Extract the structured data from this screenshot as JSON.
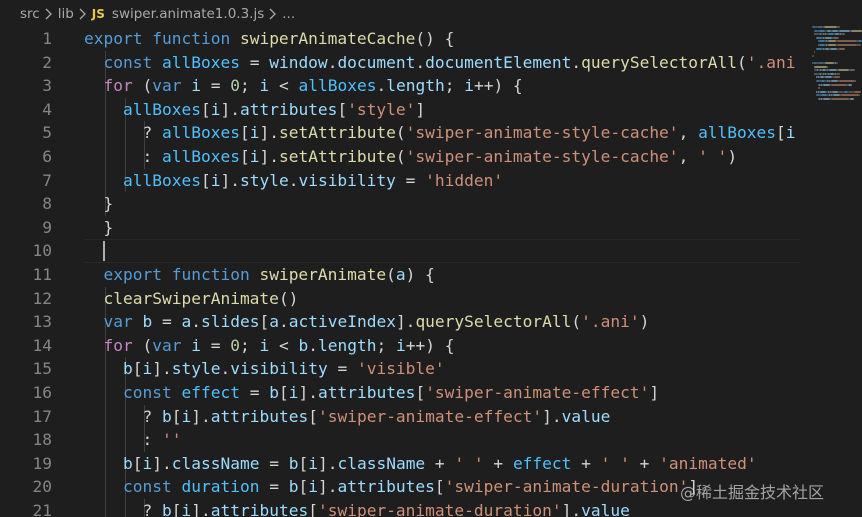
{
  "breadcrumb": {
    "items": [
      "src",
      "lib"
    ],
    "file_badge": "JS",
    "file_name": "swiper.animate1.0.3.js",
    "ellipsis": "..."
  },
  "editor": {
    "lines": [
      {
        "n": "1",
        "indent": 0,
        "tokens": [
          [
            "kw",
            "export"
          ],
          [
            "p",
            " "
          ],
          [
            "kw",
            "function"
          ],
          [
            "p",
            " "
          ],
          [
            "fn",
            "swiperAnimateCache"
          ],
          [
            "p",
            "() {"
          ]
        ]
      },
      {
        "n": "2",
        "indent": 1,
        "tokens": [
          [
            "kw",
            "const"
          ],
          [
            "p",
            " "
          ],
          [
            "const",
            "allBoxes"
          ],
          [
            "p",
            " = "
          ],
          [
            "var",
            "window"
          ],
          [
            "p",
            "."
          ],
          [
            "var",
            "document"
          ],
          [
            "p",
            "."
          ],
          [
            "var",
            "documentElement"
          ],
          [
            "p",
            "."
          ],
          [
            "fn",
            "querySelectorAll"
          ],
          [
            "p",
            "("
          ],
          [
            "str",
            "'.ani"
          ]
        ]
      },
      {
        "n": "3",
        "indent": 1,
        "tokens": [
          [
            "ctl",
            "for"
          ],
          [
            "p",
            " ("
          ],
          [
            "kw",
            "var"
          ],
          [
            "p",
            " "
          ],
          [
            "var",
            "i"
          ],
          [
            "p",
            " = "
          ],
          [
            "num",
            "0"
          ],
          [
            "p",
            "; "
          ],
          [
            "var",
            "i"
          ],
          [
            "p",
            " < "
          ],
          [
            "const",
            "allBoxes"
          ],
          [
            "p",
            "."
          ],
          [
            "var",
            "length"
          ],
          [
            "p",
            "; "
          ],
          [
            "var",
            "i"
          ],
          [
            "p",
            "++) {"
          ]
        ]
      },
      {
        "n": "4",
        "indent": 2,
        "tokens": [
          [
            "const",
            "allBoxes"
          ],
          [
            "p",
            "["
          ],
          [
            "var",
            "i"
          ],
          [
            "p",
            "]."
          ],
          [
            "var",
            "attributes"
          ],
          [
            "p",
            "["
          ],
          [
            "str",
            "'style'"
          ],
          [
            "p",
            "]"
          ]
        ]
      },
      {
        "n": "5",
        "indent": 3,
        "tokens": [
          [
            "p",
            "? "
          ],
          [
            "const",
            "allBoxes"
          ],
          [
            "p",
            "["
          ],
          [
            "var",
            "i"
          ],
          [
            "p",
            "]."
          ],
          [
            "fn",
            "setAttribute"
          ],
          [
            "p",
            "("
          ],
          [
            "str",
            "'swiper-animate-style-cache'"
          ],
          [
            "p",
            ", "
          ],
          [
            "const",
            "allBoxes"
          ],
          [
            "p",
            "["
          ],
          [
            "var",
            "i"
          ]
        ]
      },
      {
        "n": "6",
        "indent": 3,
        "tokens": [
          [
            "p",
            ": "
          ],
          [
            "const",
            "allBoxes"
          ],
          [
            "p",
            "["
          ],
          [
            "var",
            "i"
          ],
          [
            "p",
            "]."
          ],
          [
            "fn",
            "setAttribute"
          ],
          [
            "p",
            "("
          ],
          [
            "str",
            "'swiper-animate-style-cache'"
          ],
          [
            "p",
            ", "
          ],
          [
            "str",
            "' '"
          ],
          [
            "p",
            ")"
          ]
        ]
      },
      {
        "n": "7",
        "indent": 2,
        "tokens": [
          [
            "const",
            "allBoxes"
          ],
          [
            "p",
            "["
          ],
          [
            "var",
            "i"
          ],
          [
            "p",
            "]."
          ],
          [
            "var",
            "style"
          ],
          [
            "p",
            "."
          ],
          [
            "var",
            "visibility"
          ],
          [
            "p",
            " = "
          ],
          [
            "str",
            "'hidden'"
          ]
        ]
      },
      {
        "n": "8",
        "indent": 1,
        "tokens": [
          [
            "p",
            "}"
          ]
        ]
      },
      {
        "n": "9",
        "indent": 0,
        "tokens": [
          [
            "p",
            "  }"
          ]
        ]
      },
      {
        "n": "10",
        "indent": 0,
        "tokens": []
      },
      {
        "n": "11",
        "indent": 0,
        "tokens": [
          [
            "p",
            "  "
          ],
          [
            "kw",
            "export"
          ],
          [
            "p",
            " "
          ],
          [
            "kw",
            "function"
          ],
          [
            "p",
            " "
          ],
          [
            "fn",
            "swiperAnimate"
          ],
          [
            "p",
            "("
          ],
          [
            "var",
            "a"
          ],
          [
            "p",
            ") {"
          ]
        ]
      },
      {
        "n": "12",
        "indent": 1,
        "tokens": [
          [
            "fn",
            "clearSwiperAnimate"
          ],
          [
            "p",
            "()"
          ]
        ]
      },
      {
        "n": "13",
        "indent": 1,
        "tokens": [
          [
            "kw",
            "var"
          ],
          [
            "p",
            " "
          ],
          [
            "var",
            "b"
          ],
          [
            "p",
            " = "
          ],
          [
            "var",
            "a"
          ],
          [
            "p",
            "."
          ],
          [
            "var",
            "slides"
          ],
          [
            "p",
            "["
          ],
          [
            "var",
            "a"
          ],
          [
            "p",
            "."
          ],
          [
            "var",
            "activeIndex"
          ],
          [
            "p",
            "]."
          ],
          [
            "fn",
            "querySelectorAll"
          ],
          [
            "p",
            "("
          ],
          [
            "str",
            "'.ani'"
          ],
          [
            "p",
            ")"
          ]
        ]
      },
      {
        "n": "14",
        "indent": 1,
        "tokens": [
          [
            "ctl",
            "for"
          ],
          [
            "p",
            " ("
          ],
          [
            "kw",
            "var"
          ],
          [
            "p",
            " "
          ],
          [
            "var",
            "i"
          ],
          [
            "p",
            " = "
          ],
          [
            "num",
            "0"
          ],
          [
            "p",
            "; "
          ],
          [
            "var",
            "i"
          ],
          [
            "p",
            " < "
          ],
          [
            "var",
            "b"
          ],
          [
            "p",
            "."
          ],
          [
            "var",
            "length"
          ],
          [
            "p",
            "; "
          ],
          [
            "var",
            "i"
          ],
          [
            "p",
            "++) {"
          ]
        ]
      },
      {
        "n": "15",
        "indent": 2,
        "tokens": [
          [
            "var",
            "b"
          ],
          [
            "p",
            "["
          ],
          [
            "var",
            "i"
          ],
          [
            "p",
            "]."
          ],
          [
            "var",
            "style"
          ],
          [
            "p",
            "."
          ],
          [
            "var",
            "visibility"
          ],
          [
            "p",
            " = "
          ],
          [
            "str",
            "'visible'"
          ]
        ]
      },
      {
        "n": "16",
        "indent": 2,
        "tokens": [
          [
            "kw",
            "const"
          ],
          [
            "p",
            " "
          ],
          [
            "const",
            "effect"
          ],
          [
            "p",
            " = "
          ],
          [
            "var",
            "b"
          ],
          [
            "p",
            "["
          ],
          [
            "var",
            "i"
          ],
          [
            "p",
            "]."
          ],
          [
            "var",
            "attributes"
          ],
          [
            "p",
            "["
          ],
          [
            "str",
            "'swiper-animate-effect'"
          ],
          [
            "p",
            "]"
          ]
        ]
      },
      {
        "n": "17",
        "indent": 3,
        "tokens": [
          [
            "p",
            "? "
          ],
          [
            "var",
            "b"
          ],
          [
            "p",
            "["
          ],
          [
            "var",
            "i"
          ],
          [
            "p",
            "]."
          ],
          [
            "var",
            "attributes"
          ],
          [
            "p",
            "["
          ],
          [
            "str",
            "'swiper-animate-effect'"
          ],
          [
            "p",
            "]."
          ],
          [
            "var",
            "value"
          ]
        ]
      },
      {
        "n": "18",
        "indent": 3,
        "tokens": [
          [
            "p",
            ": "
          ],
          [
            "str",
            "''"
          ]
        ]
      },
      {
        "n": "19",
        "indent": 2,
        "tokens": [
          [
            "var",
            "b"
          ],
          [
            "p",
            "["
          ],
          [
            "var",
            "i"
          ],
          [
            "p",
            "]."
          ],
          [
            "var",
            "className"
          ],
          [
            "p",
            " = "
          ],
          [
            "var",
            "b"
          ],
          [
            "p",
            "["
          ],
          [
            "var",
            "i"
          ],
          [
            "p",
            "]."
          ],
          [
            "var",
            "className"
          ],
          [
            "p",
            " + "
          ],
          [
            "str",
            "' '"
          ],
          [
            "p",
            " + "
          ],
          [
            "const",
            "effect"
          ],
          [
            "p",
            " + "
          ],
          [
            "str",
            "' '"
          ],
          [
            "p",
            " + "
          ],
          [
            "str",
            "'animated'"
          ]
        ]
      },
      {
        "n": "20",
        "indent": 2,
        "tokens": [
          [
            "kw",
            "const"
          ],
          [
            "p",
            " "
          ],
          [
            "const",
            "duration"
          ],
          [
            "p",
            " = "
          ],
          [
            "var",
            "b"
          ],
          [
            "p",
            "["
          ],
          [
            "var",
            "i"
          ],
          [
            "p",
            "]."
          ],
          [
            "var",
            "attributes"
          ],
          [
            "p",
            "["
          ],
          [
            "str",
            "'swiper-animate-duration'"
          ],
          [
            "p",
            "]"
          ]
        ]
      },
      {
        "n": "21",
        "indent": 3,
        "tokens": [
          [
            "p",
            "? "
          ],
          [
            "var",
            "b"
          ],
          [
            "p",
            "["
          ],
          [
            "var",
            "i"
          ],
          [
            "p",
            "]."
          ],
          [
            "var",
            "attributes"
          ],
          [
            "p",
            "["
          ],
          [
            "str",
            "'swiper-animate-duration'"
          ],
          [
            "p",
            "]."
          ],
          [
            "var",
            "value"
          ]
        ]
      }
    ],
    "cursor_line": "10"
  },
  "watermark": "@稀土掘金技术社区",
  "colors": {
    "background": "#1e1e1e",
    "keyword": "#569cd6",
    "control": "#c586c0",
    "function": "#dcdcaa",
    "variable": "#9cdcfe",
    "constant": "#4fc1ff",
    "string": "#ce9178",
    "number": "#b5cea8",
    "line_number": "#858585",
    "js_badge": "#e8c64a"
  }
}
